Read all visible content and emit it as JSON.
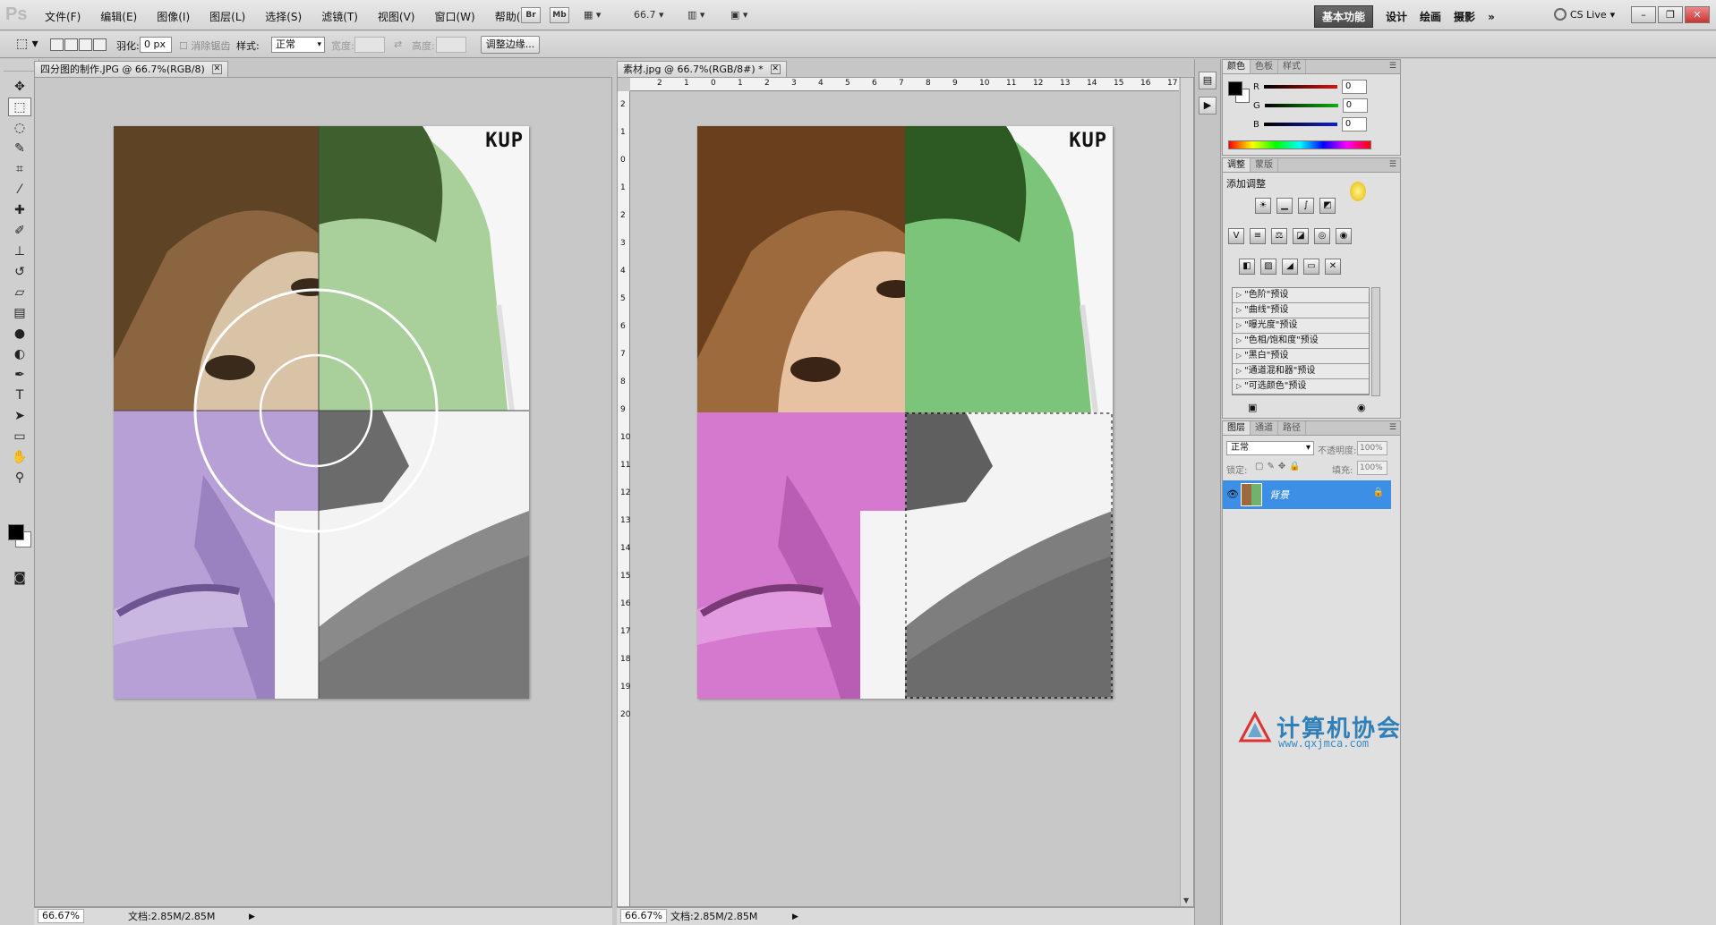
{
  "app": {
    "logo_text": "Ps"
  },
  "menu": {
    "items": [
      "文件(F)",
      "编辑(E)",
      "图像(I)",
      "图层(L)",
      "选择(S)",
      "滤镜(T)",
      "视图(V)",
      "窗口(W)",
      "帮助(H)"
    ],
    "bridge_label": "Br",
    "minibridge_label": "Mb",
    "zoom_value": "66.7",
    "workspaces": [
      "基本功能",
      "设计",
      "绘画",
      "摄影"
    ],
    "more_label": "»",
    "cslive_label": "CS Live"
  },
  "options": {
    "feather_label": "羽化:",
    "feather_value": "0 px",
    "antialias_label": "消除锯齿",
    "style_label": "样式:",
    "style_value": "正常",
    "width_label": "宽度:",
    "height_label": "高度:",
    "refine_edge_label": "调整边缘..."
  },
  "documents": [
    {
      "title": "四分图的制作.JPG @ 66.7%(RGB/8)",
      "zoom": "66.67%",
      "info": "文档:2.85M/2.85M",
      "logo_text": "KUP"
    },
    {
      "title": "素材.jpg @ 66.7%(RGB/8#) *",
      "zoom": "66.67%",
      "info": "文档:2.85M/2.85M",
      "logo_text": "KUP",
      "ruler_h": [
        "2",
        "1",
        "0",
        "1",
        "2",
        "3",
        "4",
        "5",
        "6",
        "7",
        "8",
        "9",
        "10",
        "11",
        "12",
        "13",
        "14",
        "15",
        "16",
        "17"
      ],
      "ruler_v": [
        "2",
        "1",
        "0",
        "1",
        "2",
        "3",
        "4",
        "5",
        "6",
        "7",
        "8",
        "9",
        "10",
        "11",
        "12",
        "13",
        "14",
        "15",
        "16",
        "17",
        "18",
        "19",
        "20"
      ]
    }
  ],
  "color_panel": {
    "tabs": [
      "颜色",
      "色板",
      "样式"
    ],
    "channels": [
      {
        "label": "R",
        "value": "0",
        "color": "#e01010"
      },
      {
        "label": "G",
        "value": "0",
        "color": "#10b010"
      },
      {
        "label": "B",
        "value": "0",
        "color": "#1020d0"
      }
    ]
  },
  "adjust_panel": {
    "tabs": [
      "调整",
      "蒙版"
    ],
    "heading": "添加调整",
    "presets": [
      "\"色阶\"预设",
      "\"曲线\"预设",
      "\"曝光度\"预设",
      "\"色相/饱和度\"预设",
      "\"黑白\"预设",
      "\"通道混和器\"预设",
      "\"可选颜色\"预设"
    ]
  },
  "layers_panel": {
    "tabs": [
      "图层",
      "通道",
      "路径"
    ],
    "blend_mode": "正常",
    "opacity_label": "不透明度:",
    "opacity_value": "100%",
    "lock_label": "锁定:",
    "fill_label": "填充:",
    "fill_value": "100%",
    "layer_name": "背景"
  },
  "watermark": {
    "text": "计算机协会",
    "url": "www.qxjmca.com"
  },
  "colors": {
    "quad_brown": "#8a6540",
    "quad_green": "#5fa85a",
    "quad_purple": "#8d6ab8",
    "quad_magenta": "#c254bf",
    "quad_gray": "#6e6e6e",
    "selection_blue": "#3d8fe6"
  }
}
